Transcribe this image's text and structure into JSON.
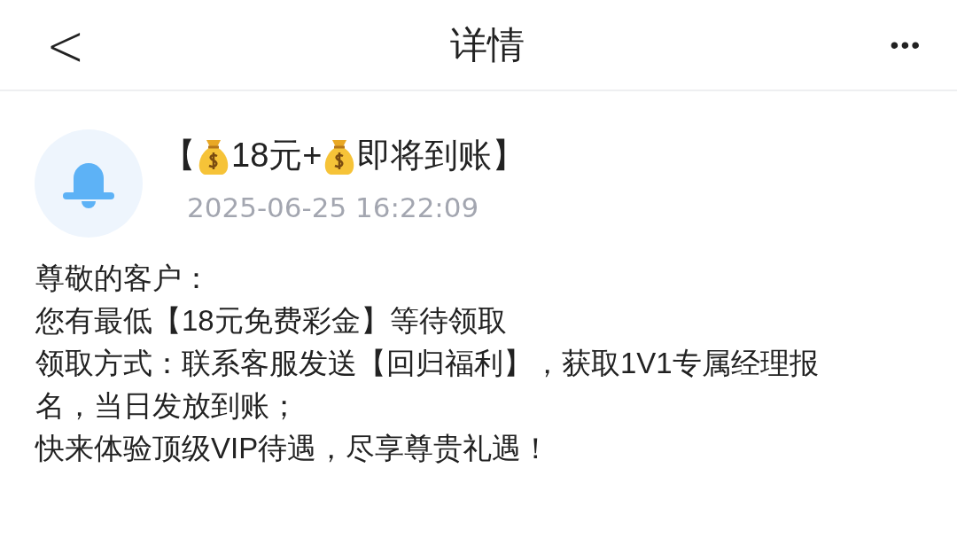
{
  "header": {
    "back": "<",
    "title": "详情",
    "more": "•••"
  },
  "message": {
    "title": [
      {
        "kind": "text",
        "text": "【"
      },
      {
        "kind": "moneybag"
      },
      {
        "kind": "text",
        "text": "18元+"
      },
      {
        "kind": "moneybag"
      },
      {
        "kind": "text",
        "text": "即将到账】"
      }
    ],
    "time": "2025-06-25 16:22:09",
    "body": [
      "尊敬的客户：",
      "您有最低【18元免费彩金】等待领取",
      "领取方式：联系客服发送【回归福利】，获取1V1专属经理报名，当日发放到账；",
      "快来体验顶级VIP待遇，尽享尊贵礼遇！"
    ]
  }
}
